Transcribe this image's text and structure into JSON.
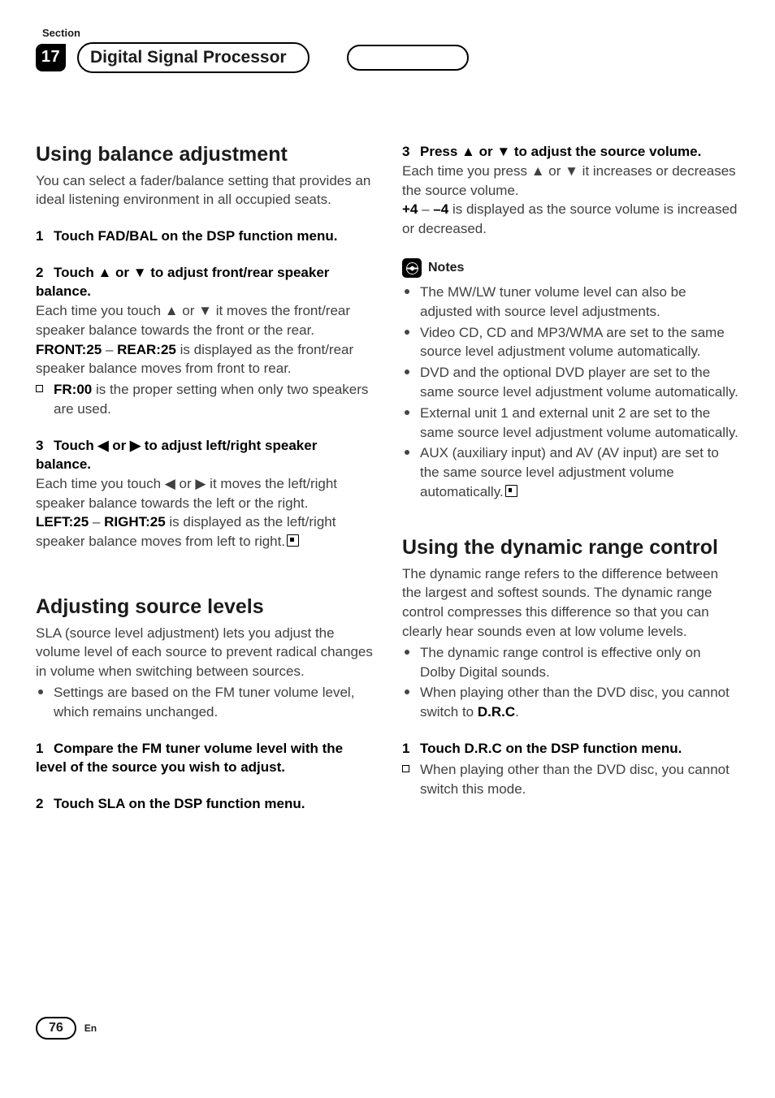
{
  "header": {
    "section_label": "Section",
    "section_number": "17",
    "chapter_title": "Digital Signal Processor"
  },
  "left": {
    "h2_balance": "Using balance adjustment",
    "balance_intro": "You can select a fader/balance setting that provides an ideal listening environment in all occupied seats.",
    "step1": "Touch FAD/BAL on the DSP function menu.",
    "step2": "Touch ▲ or ▼ to adjust front/rear speaker balance.",
    "step2_body1": "Each time you touch ▲ or ▼ it moves the front/rear speaker balance towards the front or the rear.",
    "step2_front": "FRONT:25",
    "step2_dash": " – ",
    "step2_rear": "REAR:25",
    "step2_body2": " is displayed as the front/rear speaker balance moves from front to rear.",
    "step2_fr00": "FR:00",
    "step2_body3": " is the proper setting when only two speakers are used.",
    "step3": "Touch ◀ or ▶ to adjust left/right speaker balance.",
    "step3_body1": "Each time you touch ◀ or ▶ it moves the left/right speaker balance towards the left or the right.",
    "step3_left": "LEFT:25",
    "step3_dash": " – ",
    "step3_right": "RIGHT:25",
    "step3_body2": " is displayed as the left/right speaker balance moves from left to right.",
    "h2_sla": "Adjusting source levels",
    "sla_intro": "SLA (source level adjustment) lets you adjust the volume level of each source to prevent radical changes in volume when switching between sources.",
    "sla_bullet": "Settings are based on the FM tuner volume level, which remains unchanged.",
    "sla_step1": "Compare the FM tuner volume level with the level of the source you wish to adjust.",
    "sla_step2": "Touch SLA on the DSP function menu."
  },
  "right": {
    "step3_head": "Press ▲ or ▼ to adjust the source volume.",
    "step3_body1": "Each time you press ▲ or ▼ it increases or decreases the source volume.",
    "step3_plus": "+4",
    "step3_dash": " – ",
    "step3_minus": "–4",
    "step3_body2": " is displayed as the source volume is increased or decreased.",
    "notes_label": "Notes",
    "note1": "The MW/LW tuner volume level can also be adjusted with source level adjustments.",
    "note2": "Video CD, CD and MP3/WMA are set to the same source level adjustment volume automatically.",
    "note3": "DVD and the optional DVD player are set to the same source level adjustment volume automatically.",
    "note4": "External unit 1 and external unit 2 are set to the same source level adjustment volume automatically.",
    "note5": "AUX (auxiliary input) and AV (AV input) are set to the same source level adjustment volume automatically.",
    "h2_drc": "Using the dynamic range control",
    "drc_intro": "The dynamic range refers to the difference between the largest and softest sounds. The dynamic range control compresses this difference so that you can clearly hear sounds even at low volume levels.",
    "drc_bullet1": "The dynamic range control is effective only on Dolby Digital sounds.",
    "drc_bullet2_a": "When playing other than the DVD disc, you cannot switch to ",
    "drc_bullet2_b": "D.R.C",
    "drc_bullet2_c": ".",
    "drc_step1": "Touch D.R.C on the DSP function menu.",
    "drc_step1_body": "When playing other than the DVD disc, you cannot switch this mode."
  },
  "footer": {
    "page": "76",
    "lang": "En"
  }
}
